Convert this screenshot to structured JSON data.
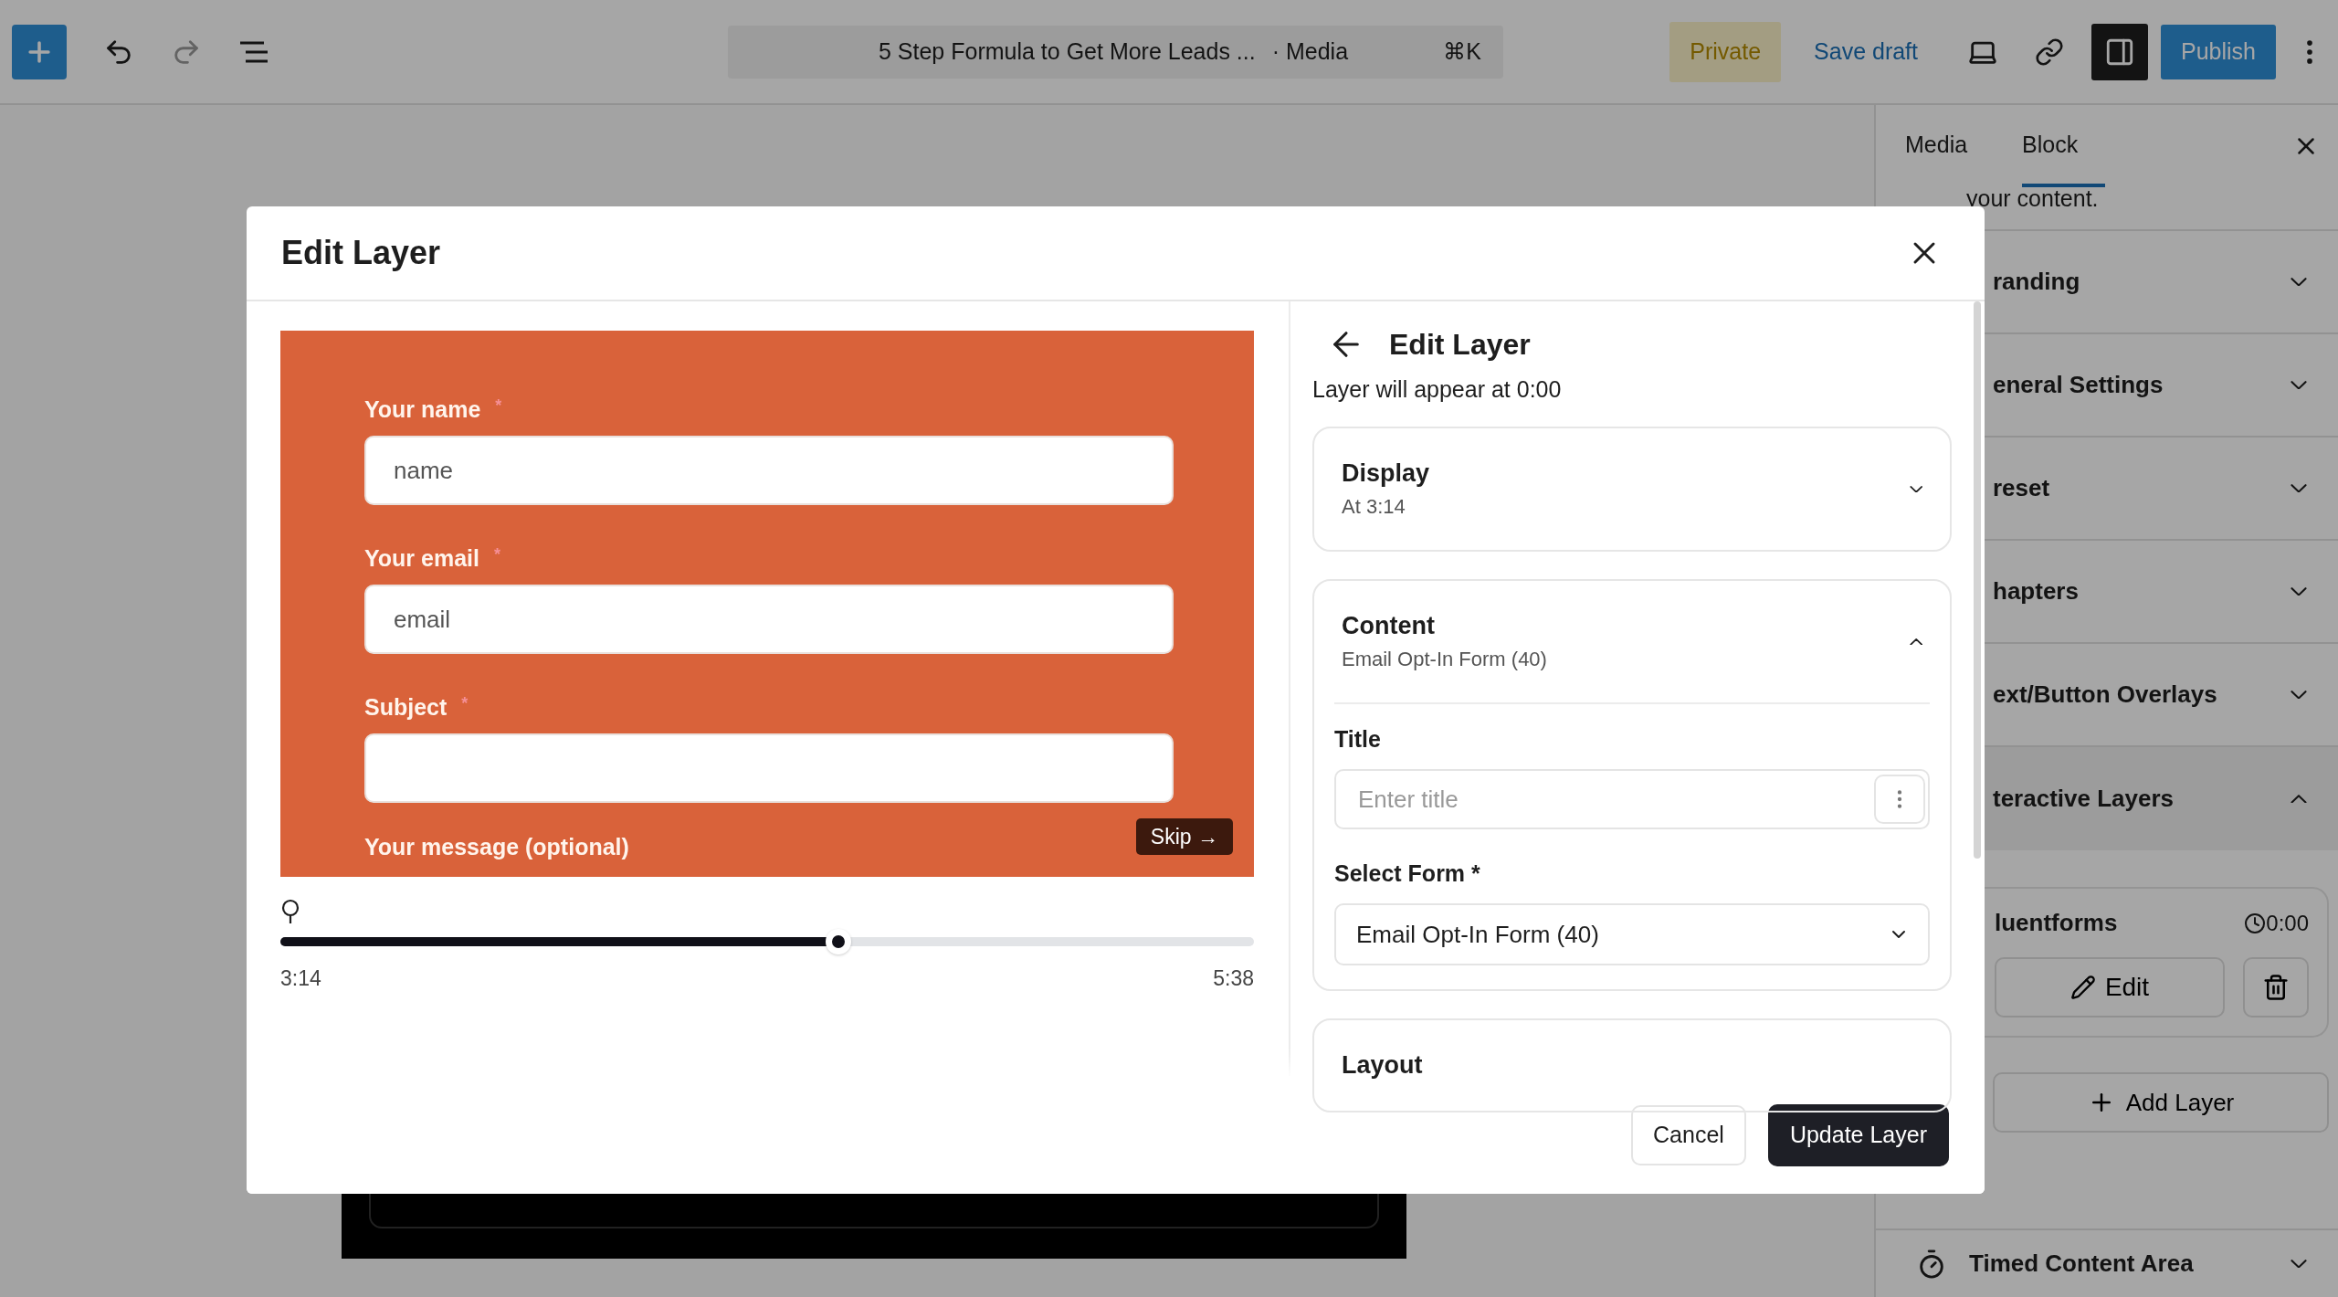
{
  "top_bar": {
    "document_title": "5 Step Formula to Get More Leads ...",
    "document_type": "· Media",
    "shortcut": "⌘K",
    "private_label": "Private",
    "save_draft": "Save draft",
    "publish": "Publish",
    "settings_open": true
  },
  "sidebar": {
    "tabs": [
      {
        "label": "Media",
        "selected": false
      },
      {
        "label": "Block",
        "selected": true
      }
    ],
    "intro_text": "your content.",
    "sections": [
      {
        "label": "randing",
        "expanded": false
      },
      {
        "label": "eneral Settings",
        "expanded": false
      },
      {
        "label": "reset",
        "expanded": false
      },
      {
        "label": "hapters",
        "expanded": false
      },
      {
        "label": "ext/Button Overlays",
        "expanded": false
      },
      {
        "label": "teractive Layers",
        "expanded": true
      }
    ],
    "layers": [
      {
        "name": "luentforms",
        "time": "0:00",
        "edit_label": "Edit"
      }
    ],
    "add_layer": "Add Layer",
    "timed_section": {
      "label": "Timed Content Area",
      "expanded": false
    }
  },
  "dialog": {
    "title": "Edit Layer",
    "preview": {
      "fields": [
        {
          "label": "Your name",
          "required_mark": "*",
          "placeholder": "name"
        },
        {
          "label": "Your email",
          "required_mark": "*",
          "placeholder": "email"
        },
        {
          "label": "Subject",
          "required_mark": "*"
        }
      ],
      "partial_label": "Your message (optional)",
      "skip": "Skip →"
    },
    "timeline": {
      "level": 0.573,
      "current": "3:14",
      "total": "5:38"
    },
    "panel": {
      "title": "Edit Layer",
      "subtitle": "Layer will appear at 0:00",
      "sections": [
        {
          "title": "Display",
          "summary": "At 3:14",
          "expanded": false
        },
        {
          "title": "Content",
          "summary": "Email Opt-In Form (40)",
          "expanded": true,
          "title_field": {
            "label": "Title",
            "placeholder": "Enter title"
          },
          "form_select": {
            "label": "Select Form *",
            "value": "Email Opt-In Form (40)"
          }
        },
        {
          "title": "Layout"
        }
      ]
    },
    "buttons": {
      "cancel": "Cancel",
      "update": "Update Layer"
    }
  }
}
